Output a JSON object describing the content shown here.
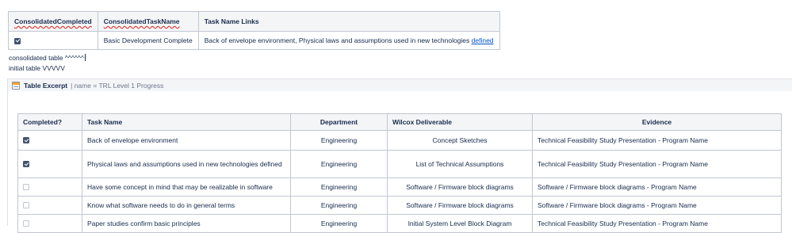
{
  "consolidated_table": {
    "headers": [
      "ConsolidatedCompleted",
      "ConsolidatedTaskName",
      "Task Name Links"
    ],
    "row": {
      "checked": true,
      "task_name": "Basic Development Complete",
      "links_text": "Back of envelope environment, Physical laws and assumptions used in new technologies ",
      "link_word": "defined"
    }
  },
  "notes": {
    "consolidated": "consolidated table ^^^^^^",
    "initial": "initial table VVVVV"
  },
  "macro": {
    "icon": "table-excerpt-icon",
    "title": "Table Excerpt",
    "params": "| name = TRL Level 1 Progress"
  },
  "excerpt_table": {
    "headers": [
      "Completed?",
      "Task Name",
      "Department",
      "Wilcox Deliverable",
      "Evidence"
    ],
    "rows": [
      {
        "checked": true,
        "task": "Back of envelope environment",
        "department": "Engineering",
        "deliverable": "Concept Sketches",
        "evidence": "Technical Feasibility Study Presentation - Program Name"
      },
      {
        "checked": true,
        "task": "Physical laws and assumptions used in new technologies defined",
        "department": "Engineering",
        "deliverable": "List of Technical Assumptions",
        "evidence": "Technical Feasibility Study Presentation - Program Name"
      },
      {
        "checked": false,
        "task": "Have some concept in mind that may be realizable in software",
        "department": "Engineering",
        "deliverable": "Software / Firmware block diagrams",
        "evidence": "Software / Firmware block diagrams - Program Name"
      },
      {
        "checked": false,
        "task": "Know what software needs to do in general terms",
        "department": "Engineering",
        "deliverable": "Software / Firmware block diagrams",
        "evidence": "Software / Firmware block diagrams - Program Name"
      },
      {
        "checked": false,
        "task": "Paper studies confirm basic principles",
        "department": "Engineering",
        "deliverable": "Initial System Level Block Diagram",
        "evidence": "Technical Feasibility Study Presentation - Program Name"
      }
    ]
  }
}
